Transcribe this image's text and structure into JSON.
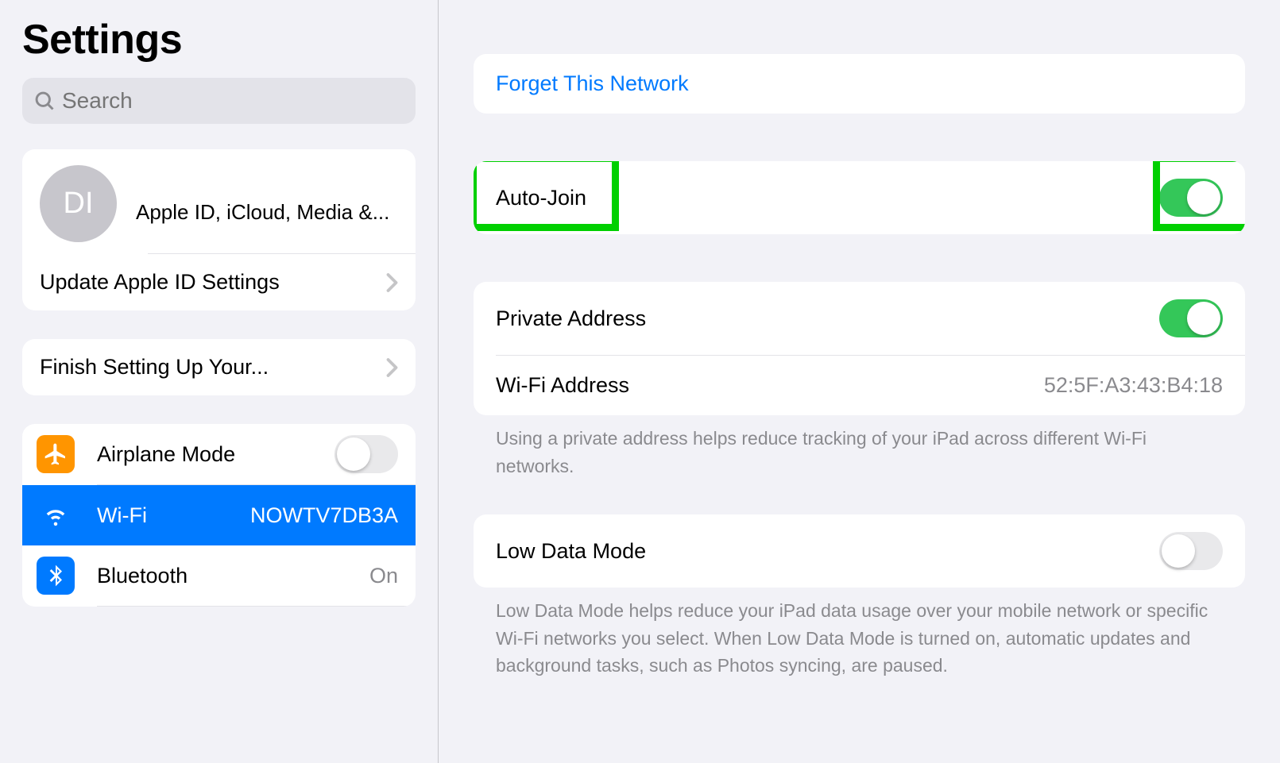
{
  "sidebar": {
    "title": "Settings",
    "search_placeholder": "Search",
    "avatar_initials": "DI",
    "apple_id_sub": "Apple ID, iCloud, Media &...",
    "update_row": "Update Apple ID Settings",
    "finish_row": "Finish Setting Up Your...",
    "items": {
      "airplane": "Airplane Mode",
      "wifi": "Wi-Fi",
      "wifi_value": "NOWTV7DB3A",
      "bluetooth": "Bluetooth",
      "bluetooth_value": "On"
    }
  },
  "detail": {
    "forget": "Forget This Network",
    "autojoin": "Auto-Join",
    "private_addr": "Private Address",
    "wifi_addr_label": "Wi-Fi Address",
    "wifi_addr_value": "52:5F:A3:43:B4:18",
    "private_note": "Using a private address helps reduce tracking of your iPad across different Wi-Fi networks.",
    "lowdata": "Low Data Mode",
    "lowdata_note": "Low Data Mode helps reduce your iPad data usage over your mobile network or specific Wi-Fi networks you select. When Low Data Mode is turned on, automatic updates and background tasks, such as Photos syncing, are paused."
  }
}
